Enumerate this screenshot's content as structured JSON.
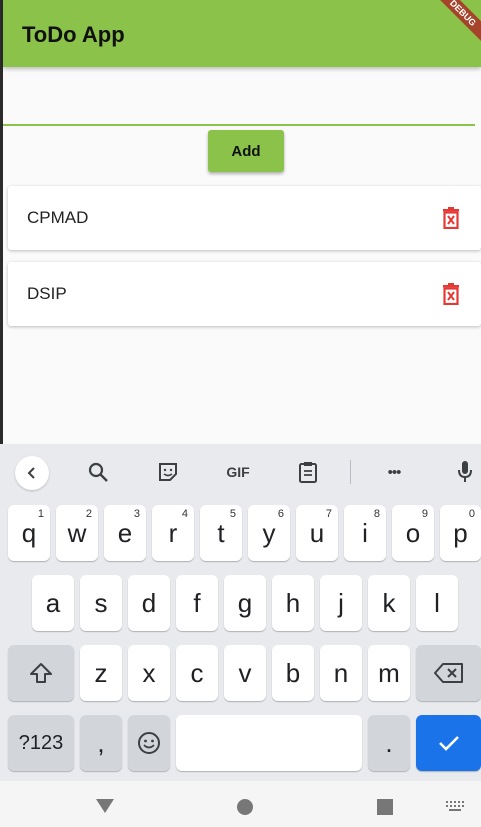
{
  "app": {
    "title": "ToDo App",
    "debug_banner": "DEBUG"
  },
  "input": {
    "value": ""
  },
  "add_button": {
    "label": "Add"
  },
  "todos": [
    {
      "label": "CPMAD"
    },
    {
      "label": "DSIP"
    }
  ],
  "keyboard": {
    "toolbar": [
      "back-icon",
      "search-icon",
      "sticker-icon",
      "gif-icon",
      "clipboard-icon",
      "more-icon",
      "mic-icon"
    ],
    "gif_label": "GIF",
    "more_label": "•••",
    "row1": [
      {
        "key": "q",
        "hint": "1"
      },
      {
        "key": "w",
        "hint": "2"
      },
      {
        "key": "e",
        "hint": "3"
      },
      {
        "key": "r",
        "hint": "4"
      },
      {
        "key": "t",
        "hint": "5"
      },
      {
        "key": "y",
        "hint": "6"
      },
      {
        "key": "u",
        "hint": "7"
      },
      {
        "key": "i",
        "hint": "8"
      },
      {
        "key": "o",
        "hint": "9"
      },
      {
        "key": "p",
        "hint": "0"
      }
    ],
    "row2": [
      "a",
      "s",
      "d",
      "f",
      "g",
      "h",
      "j",
      "k",
      "l"
    ],
    "row3": [
      "z",
      "x",
      "c",
      "v",
      "b",
      "n",
      "m"
    ],
    "row4": {
      "symbols": "?123",
      "comma": ",",
      "period": "."
    }
  },
  "colors": {
    "accent": "#8bc34a",
    "delete": "#e53935",
    "enter": "#1a73e8"
  }
}
